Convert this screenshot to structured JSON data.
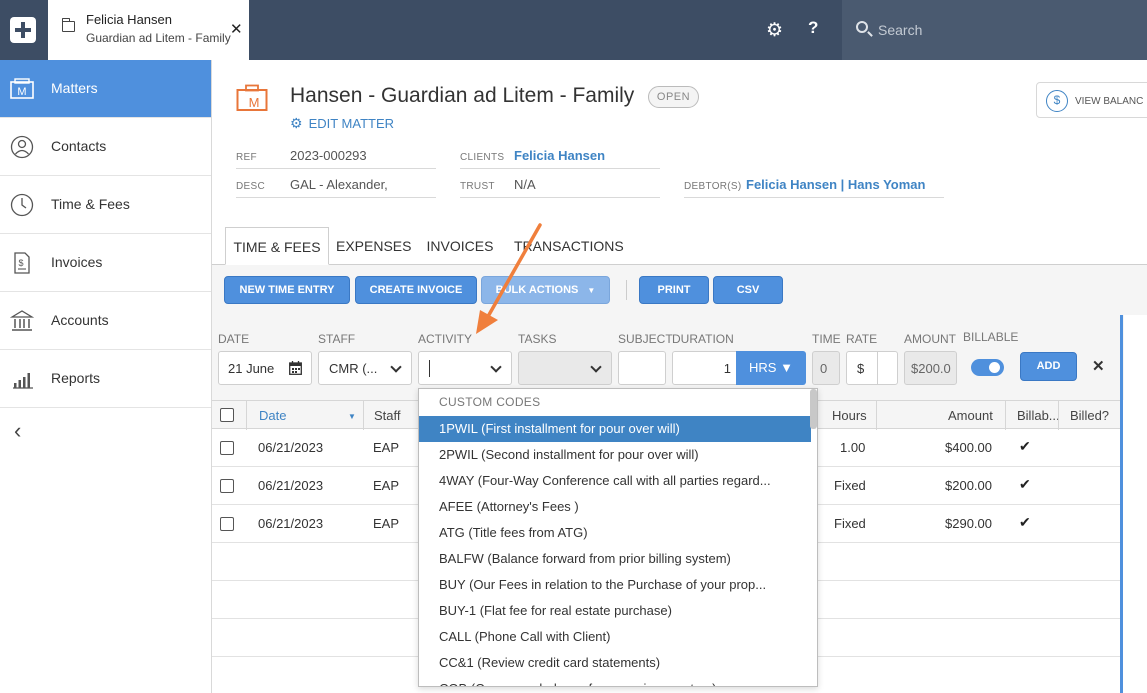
{
  "topbar": {
    "tab_title": "Felicia Hansen",
    "tab_subtitle": "Guardian ad Litem - Family",
    "search_placeholder": "Search",
    "colors": {
      "bar": "#3d4d64",
      "accent": "#4f90dd"
    }
  },
  "sidebar": {
    "items": [
      {
        "label": "Matters",
        "icon": "matters-icon",
        "active": true
      },
      {
        "label": "Contacts",
        "icon": "contacts-icon"
      },
      {
        "label": "Time & Fees",
        "icon": "clock-icon"
      },
      {
        "label": "Invoices",
        "icon": "invoice-icon"
      },
      {
        "label": "Accounts",
        "icon": "bank-icon"
      },
      {
        "label": "Reports",
        "icon": "bar-chart-icon"
      }
    ]
  },
  "matter": {
    "title": "Hansen - Guardian ad Litem - Family",
    "status": "OPEN",
    "edit_label": "EDIT MATTER",
    "view_balance_label": "VIEW BALANC",
    "ref_label": "REF",
    "ref": "2023-000293",
    "desc_label": "DESC",
    "desc": "GAL - Alexander,",
    "clients_label": "CLIENTS",
    "clients": "Felicia Hansen",
    "trust_label": "TRUST",
    "trust": "N/A",
    "debtors_label": "DEBTOR(S)",
    "debtors": "Felicia Hansen | Hans Yoman"
  },
  "tabs": [
    "TIME & FEES",
    "EXPENSES",
    "INVOICES",
    "TRANSACTIONS"
  ],
  "toolbar": {
    "new_time_entry": "NEW TIME ENTRY",
    "create_invoice": "CREATE INVOICE",
    "bulk_actions": "BULK ACTIONS",
    "print": "PRINT",
    "csv": "CSV"
  },
  "entry": {
    "labels": {
      "date": "DATE",
      "staff": "STAFF",
      "activity": "ACTIVITY",
      "tasks": "TASKS",
      "subject": "SUBJECT",
      "duration": "DURATION",
      "time": "TIME",
      "rate": "RATE",
      "amount": "AMOUNT",
      "billable": "BILLABLE"
    },
    "date": "21 June",
    "staff": "CMR (...",
    "duration": "1",
    "unit": "HRS ▼",
    "time": "0",
    "rate_symbol": "$",
    "amount": "$200.0",
    "billable": true,
    "add_label": "ADD"
  },
  "table": {
    "headers": [
      "Date",
      "Staff",
      "Hours",
      "Amount",
      "Billab...",
      "Billed?"
    ],
    "rows": [
      {
        "date": "06/21/2023",
        "staff": "EAP",
        "hours": "1.00",
        "amount": "$400.00",
        "billable": true
      },
      {
        "date": "06/21/2023",
        "staff": "EAP",
        "hours": "Fixed",
        "amount": "$200.00",
        "billable": true
      },
      {
        "date": "06/21/2023",
        "staff": "EAP",
        "hours": "Fixed",
        "amount": "$290.00",
        "billable": true
      }
    ]
  },
  "activity_dropdown": {
    "header": "CUSTOM CODES",
    "selected_index": 0,
    "options": [
      "1PWIL (First installment for pour over will)",
      "2PWIL (Second installment for pour over will)",
      "4WAY (Four-Way Conference call with all parties regard...",
      "AFEE (Attorney's Fees )",
      "ATG (Title fees from ATG)",
      "BALFW (Balance forward from prior billing system)",
      "BUY (Our Fees in relation to the Purchase of your prop...",
      "BUY-1 (Flat fee for real estate purchase)",
      "CALL (Phone Call with Client)",
      "CC&1 (Review credit card statements)",
      "COB (Carry over balance from previous system)"
    ]
  },
  "annotation": {
    "arrow_color": "#f07f3c"
  }
}
